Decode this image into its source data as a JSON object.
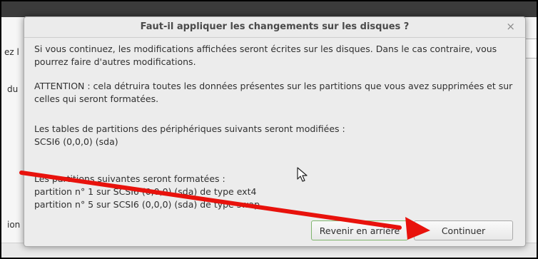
{
  "background": {
    "left_snippets": [
      "ez l",
      "du",
      "ion"
    ]
  },
  "dialog": {
    "title": "Faut-il appliquer les changements sur les disques ?",
    "close_glyph": "×",
    "paragraph1": "Si vous continuez, les modifications affichées seront écrites sur les disques. Dans le cas contraire, vous pourrez faire d'autres modifications.",
    "paragraph2": "ATTENTION : cela détruira toutes les données présentes sur les partitions que vous avez supprimées et sur celles qui seront formatées.",
    "paragraph3_heading": "Les tables de partitions des périphériques suivants seront modifiées :",
    "paragraph3_item": " SCSI6 (0,0,0) (sda)",
    "paragraph4_heading": "Les partitions suivantes seront formatées :",
    "paragraph4_items": [
      " partition n° 1 sur SCSI6 (0,0,0) (sda) de type ext4",
      " partition n° 5 sur SCSI6 (0,0,0) (sda) de type swap"
    ],
    "back_label": "Revenir en arrière",
    "continue_label": "Continuer"
  },
  "annotation": {
    "arrow_color": "#e8120c"
  }
}
